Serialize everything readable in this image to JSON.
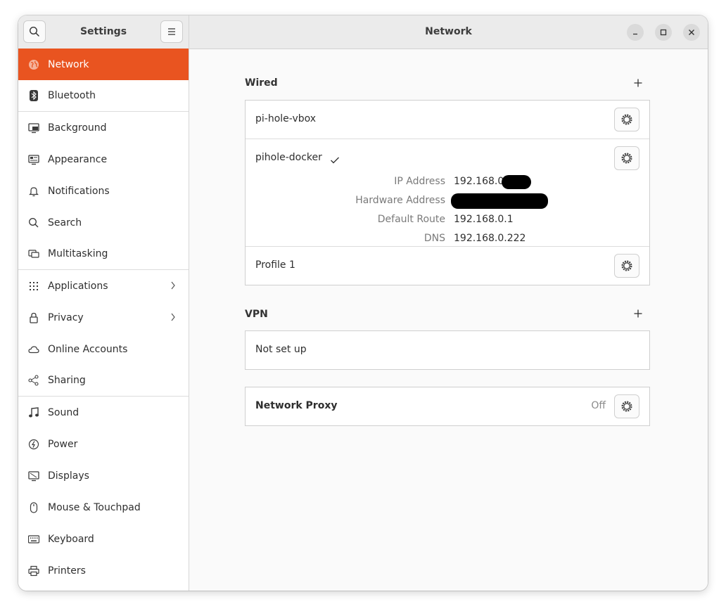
{
  "sidebar": {
    "title": "Settings",
    "items": [
      {
        "label": "Network",
        "icon": "globe-icon"
      },
      {
        "label": "Bluetooth",
        "icon": "bluetooth-icon"
      },
      {
        "label": "Background",
        "icon": "monitor-icon"
      },
      {
        "label": "Appearance",
        "icon": "appearance-icon"
      },
      {
        "label": "Notifications",
        "icon": "bell-icon"
      },
      {
        "label": "Search",
        "icon": "search-icon"
      },
      {
        "label": "Multitasking",
        "icon": "multitasking-icon"
      },
      {
        "label": "Applications",
        "icon": "grid-icon"
      },
      {
        "label": "Privacy",
        "icon": "lock-icon"
      },
      {
        "label": "Online Accounts",
        "icon": "cloud-icon"
      },
      {
        "label": "Sharing",
        "icon": "share-icon"
      },
      {
        "label": "Sound",
        "icon": "music-note-icon"
      },
      {
        "label": "Power",
        "icon": "power-icon"
      },
      {
        "label": "Displays",
        "icon": "display-icon"
      },
      {
        "label": "Mouse & Touchpad",
        "icon": "mouse-icon"
      },
      {
        "label": "Keyboard",
        "icon": "keyboard-icon"
      },
      {
        "label": "Printers",
        "icon": "printer-icon"
      }
    ]
  },
  "header": {
    "title": "Network"
  },
  "wired": {
    "title": "Wired",
    "profiles": [
      {
        "name": "pi-hole-vbox"
      },
      {
        "name": "pihole-docker",
        "active": true,
        "details": {
          "ip_label": "IP Address",
          "ip_value": "192.168.0.",
          "hw_label": "Hardware Address",
          "hw_value": "",
          "route_label": "Default Route",
          "route_value": "192.168.0.1",
          "dns_label": "DNS",
          "dns_value": "192.168.0.222"
        }
      },
      {
        "name": "Profile 1"
      }
    ]
  },
  "vpn": {
    "title": "VPN",
    "status": "Not set up"
  },
  "proxy": {
    "label": "Network Proxy",
    "status": "Off"
  },
  "colors": {
    "accent": "#e95420"
  }
}
